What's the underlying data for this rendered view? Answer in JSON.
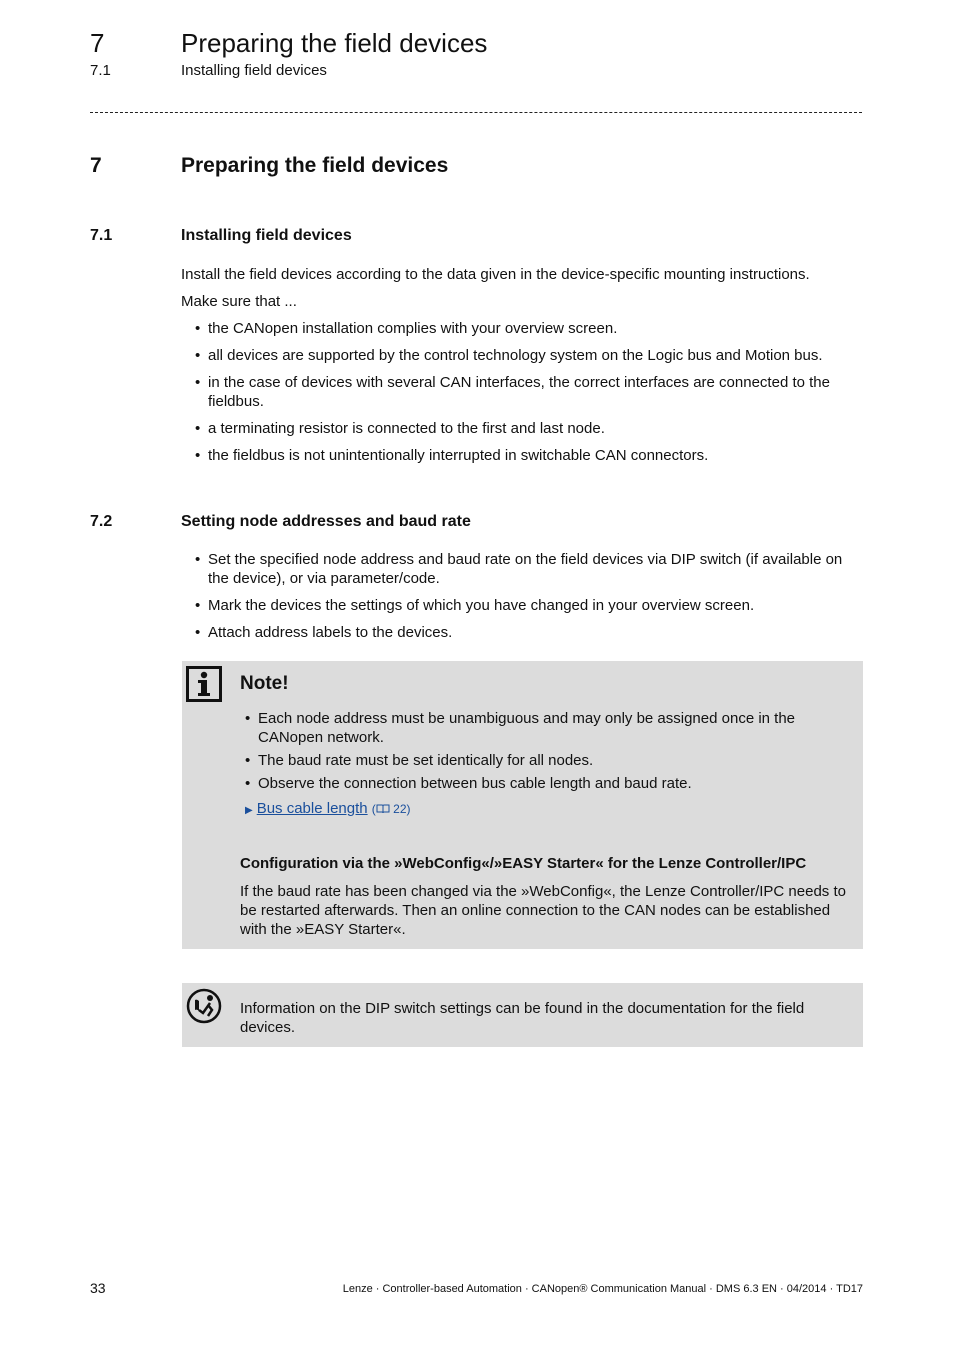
{
  "running_header": {
    "chapter_number": "7",
    "chapter_title": "Preparing the field devices",
    "section_number": "7.1",
    "section_title": "Installing field devices"
  },
  "chapter": {
    "number": "7",
    "title": "Preparing the field devices"
  },
  "section_7_1": {
    "number": "7.1",
    "title": "Installing field devices",
    "intro": "Install the field devices according to the data given in the device-specific mounting instructions.",
    "lead": "Make sure that ...",
    "bullets": [
      "the CANopen installation complies with your overview screen.",
      "all devices are supported by the control technology system on the Logic bus and Motion bus.",
      "in the case of devices with several CAN interfaces, the correct interfaces are connected to the fieldbus.",
      "a terminating resistor is connected to the first and last node.",
      "the fieldbus is not unintentionally interrupted in switchable CAN connectors."
    ]
  },
  "section_7_2": {
    "number": "7.2",
    "title": "Setting node addresses and baud rate",
    "bullets": [
      "Set the specified node address and baud rate on the field devices via DIP switch (if available on the device), or via parameter/code.",
      "Mark the devices the settings of which you have changed in your overview screen.",
      "Attach address labels to the devices."
    ]
  },
  "note": {
    "icon": "info-icon",
    "title": "Note!",
    "bullets": [
      "Each node address must be unambiguous and may only be assigned once in the CANopen network.",
      "The baud rate must be set identically for all nodes.",
      "Observe the connection between bus cable length and baud rate."
    ],
    "link_arrow": "▶",
    "link_text": "Bus cable length",
    "link_ref_open": "(",
    "link_ref_icon": "book-icon",
    "link_ref_page": "22",
    "link_ref_close": ")",
    "subheading": "Configuration via the »WebConfig«/»EASY Starter« for the Lenze Controller/IPC",
    "subtext": "If the baud rate has been changed via the »WebConfig«, the Lenze Controller/IPC needs to be restarted afterwards. Then an online connection to the CAN nodes can be established with the »EASY Starter«."
  },
  "tip": {
    "icon": "reading-person-icon",
    "text": "Information on the DIP switch settings can be found in the documentation for the field devices."
  },
  "footer": {
    "page_number": "33",
    "text": "Lenze · Controller-based Automation · CANopen® Communication Manual · DMS 6.3 EN · 04/2014 · TD17"
  }
}
